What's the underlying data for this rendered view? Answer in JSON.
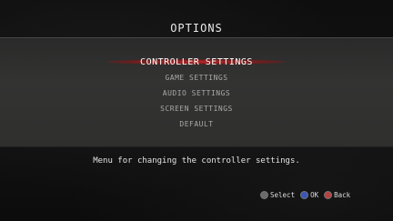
{
  "title": "OPTIONS",
  "menu": {
    "items": [
      {
        "label": "CONTROLLER SETTINGS"
      },
      {
        "label": "GAME SETTINGS"
      },
      {
        "label": "AUDIO SETTINGS"
      },
      {
        "label": "SCREEN SETTINGS"
      },
      {
        "label": "DEFAULT"
      }
    ],
    "selected_index": 0
  },
  "description": "Menu for changing the controller settings.",
  "controls": {
    "select": {
      "label": "Select",
      "icon": "left-stick-icon",
      "color": "#6b6b6b"
    },
    "ok": {
      "label": "OK",
      "icon": "cross-button-icon",
      "color": "#3a55b8"
    },
    "back": {
      "label": "Back",
      "icon": "circle-button-icon",
      "color": "#b54242"
    }
  },
  "colors": {
    "highlight": "#c82828",
    "panel": "#333332",
    "background": "#0e0e0e"
  }
}
